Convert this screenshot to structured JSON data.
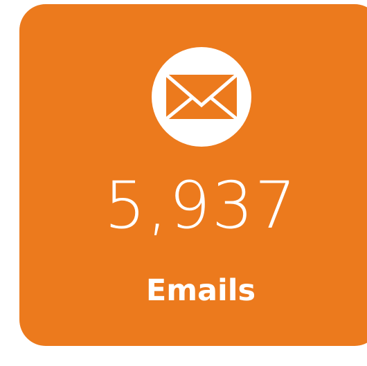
{
  "card": {
    "icon": "envelope-icon",
    "count": "5,937",
    "label": "Emails"
  },
  "colors": {
    "card_background": "#ec7a1d",
    "icon_circle": "#ffffff",
    "text": "#ffffff"
  }
}
